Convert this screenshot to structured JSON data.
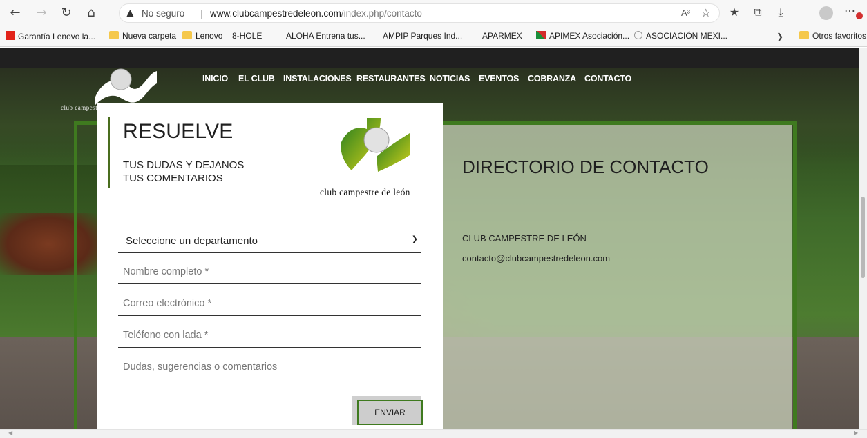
{
  "browser": {
    "security_label": "No seguro",
    "url_host": "www.clubcampestredeleon.com",
    "url_path": "/index.php/contacto",
    "read_aloud": "A³",
    "bookmarks": [
      {
        "label": "Garantía Lenovo la...",
        "icon": "lenovo"
      },
      {
        "label": "Nueva carpeta",
        "icon": "folder"
      },
      {
        "label": "Lenovo",
        "icon": "folder"
      },
      {
        "label": "8-HOLE",
        "icon": "page"
      },
      {
        "label": "ALOHA Entrena tus...",
        "icon": "page"
      },
      {
        "label": "AMPIP Parques Ind...",
        "icon": "page"
      },
      {
        "label": "APARMEX",
        "icon": "page"
      },
      {
        "label": "APIMEX Asociación...",
        "icon": "apimex"
      },
      {
        "label": "ASOCIACIÓN MEXI...",
        "icon": "amx"
      }
    ],
    "other_favorites": "Otros favoritos"
  },
  "site": {
    "logo_text": "club campestre de león",
    "nav": [
      "INICIO",
      "EL CLUB",
      "INSTALACIONES",
      "RESTAURANTES",
      "NOTICIAS",
      "EVENTOS",
      "COBRANZA",
      "CONTACTO"
    ]
  },
  "form": {
    "title": "RESUELVE",
    "subtitle_line1": "TUS DUDAS Y DEJANOS",
    "subtitle_line2": "TUS COMENTARIOS",
    "logo_caption": "club campestre de león",
    "department_selected": "Seleccione un departamento",
    "name_placeholder": "Nombre completo *",
    "email_placeholder": "Correo electrónico *",
    "phone_placeholder": "Teléfono con lada *",
    "comments_placeholder": "Dudas, sugerencias o comentarios",
    "submit_label": "ENVIAR"
  },
  "directory": {
    "title": "DIRECTORIO DE CONTACTO",
    "name": "CLUB CAMPESTRE DE LEÓN",
    "email": "contacto@clubcampestredeleon.com"
  },
  "colors": {
    "brand_green": "#3f7a1f",
    "nav_text": "#ffffff"
  }
}
